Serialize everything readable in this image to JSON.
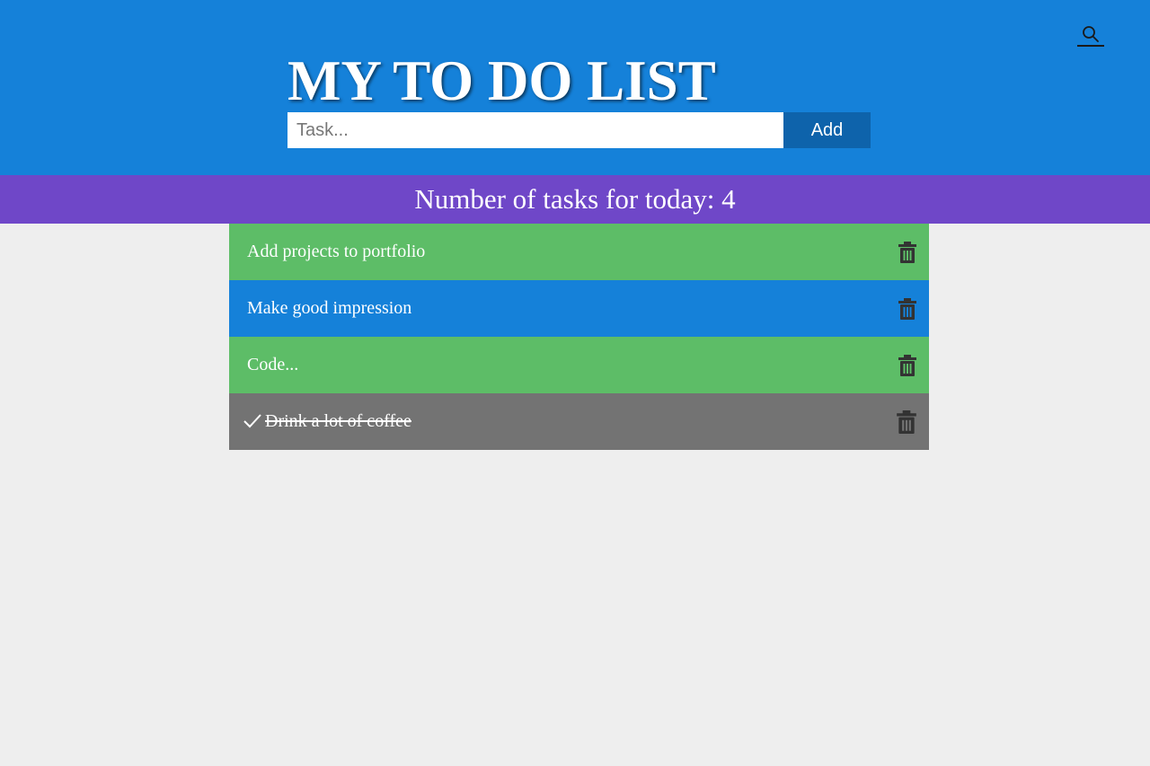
{
  "header": {
    "title": "MY TO DO LIST",
    "search_icon": "search-icon",
    "background_color": "#1581d9"
  },
  "form": {
    "placeholder": "Task...",
    "value": "",
    "add_label": "Add"
  },
  "summary": {
    "text": "Number of tasks for today: 4",
    "background_color": "#6f47c8"
  },
  "tasks": [
    {
      "text": "Add projects to portfolio",
      "color": "#5dbd67",
      "done": false,
      "icon": "trash-icon"
    },
    {
      "text": "Make good impression",
      "color": "#1581d9",
      "done": false,
      "icon": "trash-icon"
    },
    {
      "text": "Code...",
      "color": "#5dbd67",
      "done": false,
      "icon": "trash-icon"
    },
    {
      "text": "Drink a lot of coffee",
      "color": "#737373",
      "done": true,
      "icon": "trash-icon",
      "done_icon": "check-icon"
    }
  ]
}
